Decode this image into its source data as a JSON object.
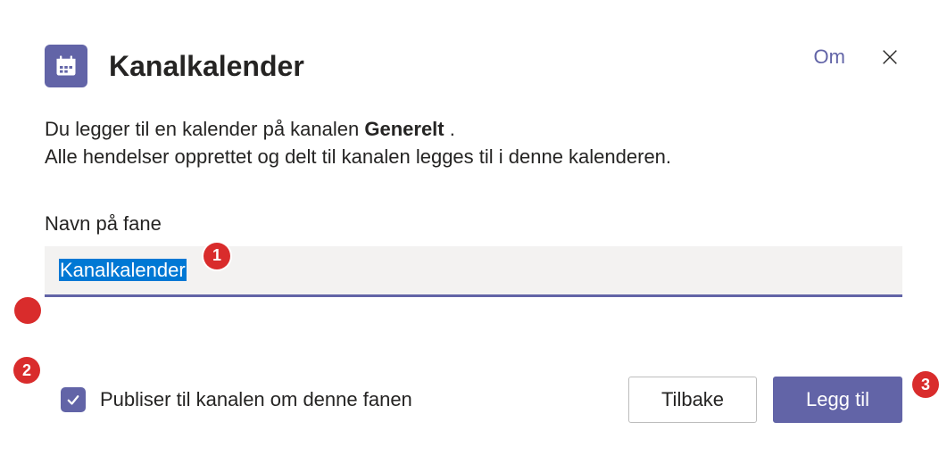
{
  "header": {
    "title": "Kanalkalender",
    "about": "Om"
  },
  "description": {
    "line1_prefix": "Du legger til en kalender på kanalen ",
    "line1_bold": "Generelt",
    "line1_suffix": " .",
    "line2": "Alle hendelser opprettet og delt til kanalen legges til i denne kalenderen."
  },
  "field": {
    "label": "Navn på fane",
    "value": "Kanalkalender"
  },
  "footer": {
    "checkbox_label": "Publiser til kanalen om denne fanen",
    "checkbox_checked": true,
    "back": "Tilbake",
    "add": "Legg til"
  },
  "annotations": {
    "b1": "1",
    "b2": "2",
    "b3": "3"
  }
}
